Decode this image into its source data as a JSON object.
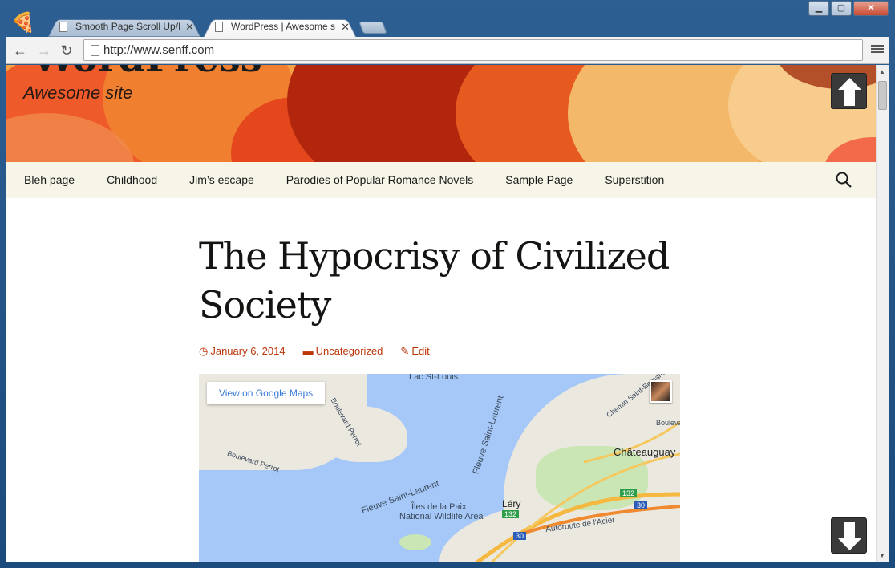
{
  "browser": {
    "tabs": [
      {
        "label": "Smooth Page Scroll Up/Do",
        "active": false
      },
      {
        "label": "WordPress | Awesome site",
        "active": true
      }
    ],
    "url": "http://www.senff.com"
  },
  "site": {
    "title": "WordPress",
    "tagline": "Awesome site"
  },
  "nav": {
    "items": [
      "Bleh page",
      "Childhood",
      "Jim’s escape",
      "Parodies of Popular Romance Novels",
      "Sample Page",
      "Superstition"
    ]
  },
  "post": {
    "title": "The Hypocrisy of Civilized Society",
    "date": "January 6, 2014",
    "category": "Uncategorized",
    "edit": "Edit"
  },
  "map": {
    "link": "View on Google Maps",
    "labels": {
      "lac": "Lac St-Louis",
      "fleuve1": "Fleuve Saint-Laurent",
      "fleuve2": "Fleuve Saint-Laurent",
      "iles": "Îles de la Paix",
      "wildlife": "National Wildlife Area",
      "lery": "Léry",
      "chateauguay": "Châteauguay",
      "autoroute": "Autoroute de l'Acier",
      "bperrot1": "Boulevard Perrot",
      "bperrot2": "Boulevard Perrot",
      "chemin": "Chemin Saint-Bernard",
      "boulev": "Bouleva",
      "r132": "132",
      "r30a": "30",
      "r30b": "30",
      "r132b": "132"
    }
  },
  "colors": {
    "accent": "#bc360a",
    "navbar": "#f7f5e7",
    "header": "#f6a347"
  }
}
